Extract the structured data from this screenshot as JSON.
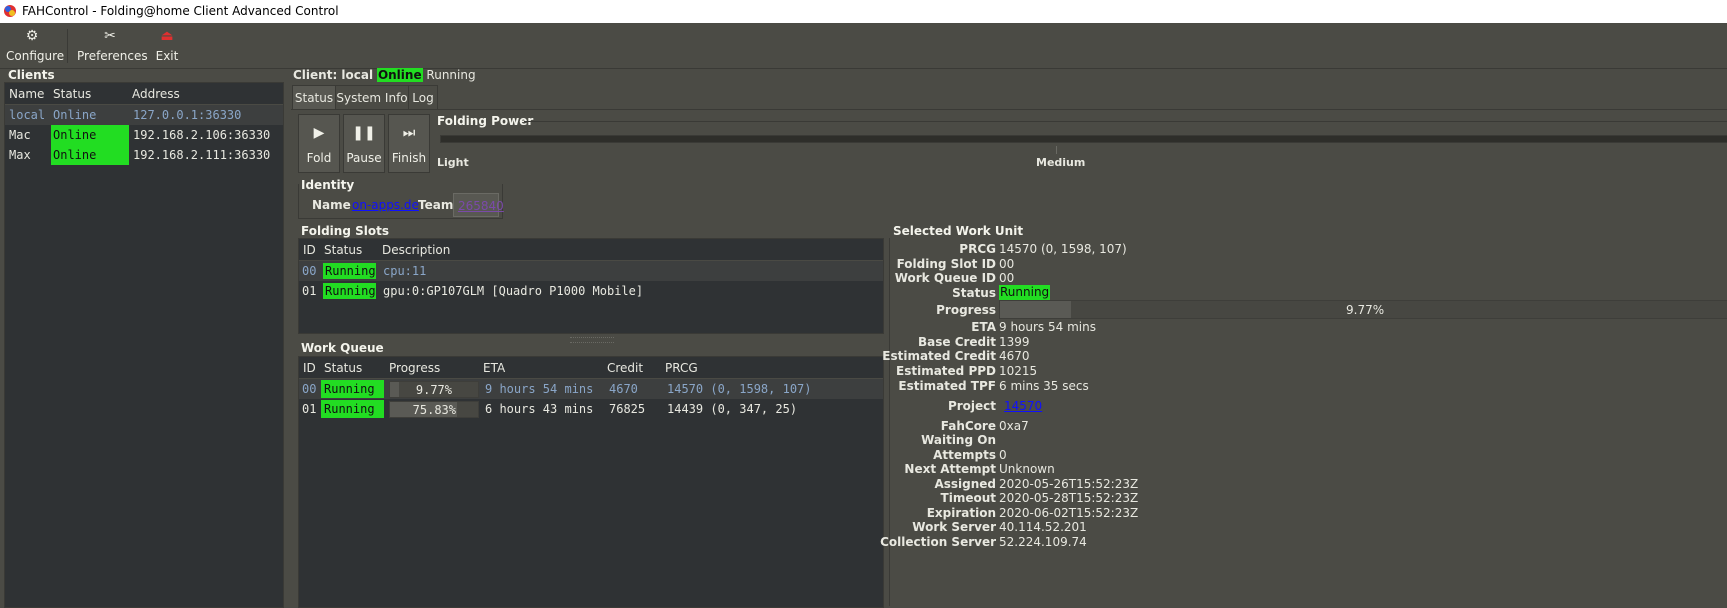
{
  "window": {
    "title": "FAHControl - Folding@home Client Advanced Control"
  },
  "toolbar": {
    "configure": "Configure",
    "preferences": "Preferences",
    "exit": "Exit"
  },
  "clients": {
    "title": "Clients",
    "headers": [
      "Name",
      "Status",
      "Address"
    ],
    "rows": [
      {
        "name": "local",
        "status": "Online",
        "address": "127.0.0.1:36330"
      },
      {
        "name": "Mac",
        "status": "Online",
        "address": "192.168.2.106:36330"
      },
      {
        "name": "Max",
        "status": "Online",
        "address": "192.168.2.111:36330"
      }
    ]
  },
  "client_header": {
    "prefix": "Client: local",
    "online": "Online",
    "running": "Running"
  },
  "tabs": [
    "Status",
    "System Info",
    "Log"
  ],
  "controls": {
    "fold": "Fold",
    "pause": "Pause",
    "finish": "Finish"
  },
  "folding_power": {
    "title": "Folding Power",
    "light": "Light",
    "medium": "Medium"
  },
  "identity": {
    "title": "Identity",
    "name_label": "Name",
    "name_value": "on-apps.de",
    "team_label": "Team",
    "team_value": "265840"
  },
  "folding_slots": {
    "title": "Folding Slots",
    "headers": [
      "ID",
      "Status",
      "Description"
    ],
    "rows": [
      {
        "id": "00",
        "status": "Running",
        "description": "cpu:11"
      },
      {
        "id": "01",
        "status": "Running",
        "description": "gpu:0:GP107GLM [Quadro P1000 Mobile]"
      }
    ]
  },
  "work_queue": {
    "title": "Work Queue",
    "headers": [
      "ID",
      "Status",
      "Progress",
      "ETA",
      "Credit",
      "PRCG"
    ],
    "rows": [
      {
        "id": "00",
        "status": "Running",
        "progress": "9.77%",
        "progress_value": 0.0977,
        "eta": "9 hours 54 mins",
        "credit": "4670",
        "prcg": "14570 (0, 1598, 107)"
      },
      {
        "id": "01",
        "status": "Running",
        "progress": "75.83%",
        "progress_value": 0.7583,
        "eta": "6 hours 43 mins",
        "credit": "76825",
        "prcg": "14439 (0, 347, 25)"
      }
    ]
  },
  "selected_work_unit": {
    "title": "Selected Work Unit",
    "prcg_label": "PRCG",
    "prcg": "14570 (0, 1598, 107)",
    "slot_label": "Folding Slot ID",
    "slot": "00",
    "queue_label": "Work Queue ID",
    "queue": "00",
    "status_label": "Status",
    "status": "Running",
    "progress_label": "Progress",
    "progress": "9.77%",
    "progress_value": 0.0977,
    "eta_label": "ETA",
    "eta": "9 hours 54 mins",
    "base_credit_label": "Base Credit",
    "base_credit": "1399",
    "est_credit_label": "Estimated Credit",
    "est_credit": "4670",
    "est_ppd_label": "Estimated PPD",
    "est_ppd": "10215",
    "est_tpf_label": "Estimated TPF",
    "est_tpf": "6 mins 35 secs",
    "project_label": "Project",
    "project": "14570",
    "fahcore_label": "FahCore",
    "fahcore": "0xa7",
    "waiting_label": "Waiting On",
    "waiting": "",
    "attempts_label": "Attempts",
    "attempts": "0",
    "next_attempt_label": "Next Attempt",
    "next_attempt": "Unknown",
    "assigned_label": "Assigned",
    "assigned": "2020-05-26T15:52:23Z",
    "timeout_label": "Timeout",
    "timeout": "2020-05-28T15:52:23Z",
    "expiration_label": "Expiration",
    "expiration": "2020-06-02T15:52:23Z",
    "work_server_label": "Work Server",
    "work_server": "40.114.52.201",
    "collection_server_label": "Collection Server",
    "collection_server": "52.224.109.74"
  }
}
